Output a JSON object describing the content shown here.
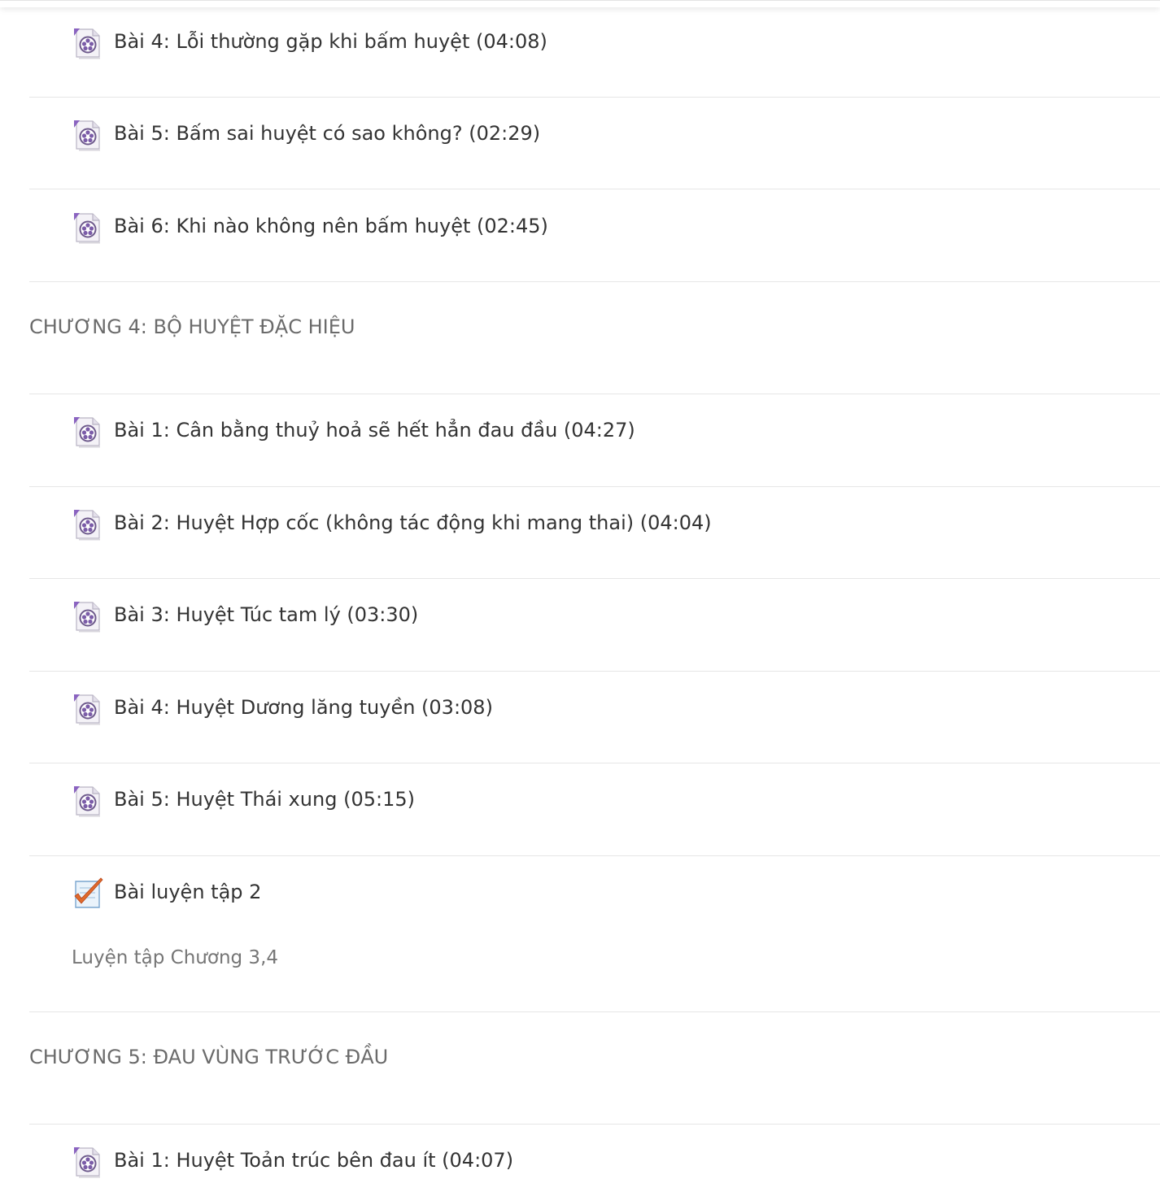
{
  "colors": {
    "text": "#333333",
    "section_text": "#6b6b6b",
    "description_text": "#767676",
    "divider": "#e6e6e6",
    "video_icon_accent": "#7b5ca8",
    "quiz_check": "#e06a2c"
  },
  "icons": {
    "video": "video-file-icon",
    "quiz": "quiz-checkbox-icon"
  },
  "chapter3": {
    "items": [
      {
        "label": "Bài 4: Lỗi thường gặp khi bấm huyệt (04:08)"
      },
      {
        "label": "Bài 5: Bấm sai huyệt có sao không? (02:29)"
      },
      {
        "label": "Bài 6: Khi nào không nên bấm huyệt (02:45)"
      }
    ]
  },
  "chapter4": {
    "title": "CHƯƠNG 4: BỘ HUYỆT ĐẶC HIỆU",
    "items": [
      {
        "label": "Bài 1: Cân bằng thuỷ hoả sẽ hết hẳn đau đầu (04:27)"
      },
      {
        "label": "Bài 2: Huyệt Hợp cốc (không tác động khi mang thai) (04:04)"
      },
      {
        "label": "Bài 3: Huyệt Túc tam lý (03:30)"
      },
      {
        "label": "Bài 4: Huyệt Dương lăng tuyền (03:08)"
      },
      {
        "label": "Bài 5: Huyệt Thái xung (05:15)"
      }
    ],
    "quiz": {
      "label": "Bài luyện tập 2",
      "description": "Luyện tập Chương 3,4"
    }
  },
  "chapter5": {
    "title": "CHƯƠNG 5: ĐAU VÙNG TRƯỚC ĐẦU",
    "items": [
      {
        "label": "Bài 1: Huyệt Toản trúc bên đau ít (04:07)"
      }
    ]
  }
}
